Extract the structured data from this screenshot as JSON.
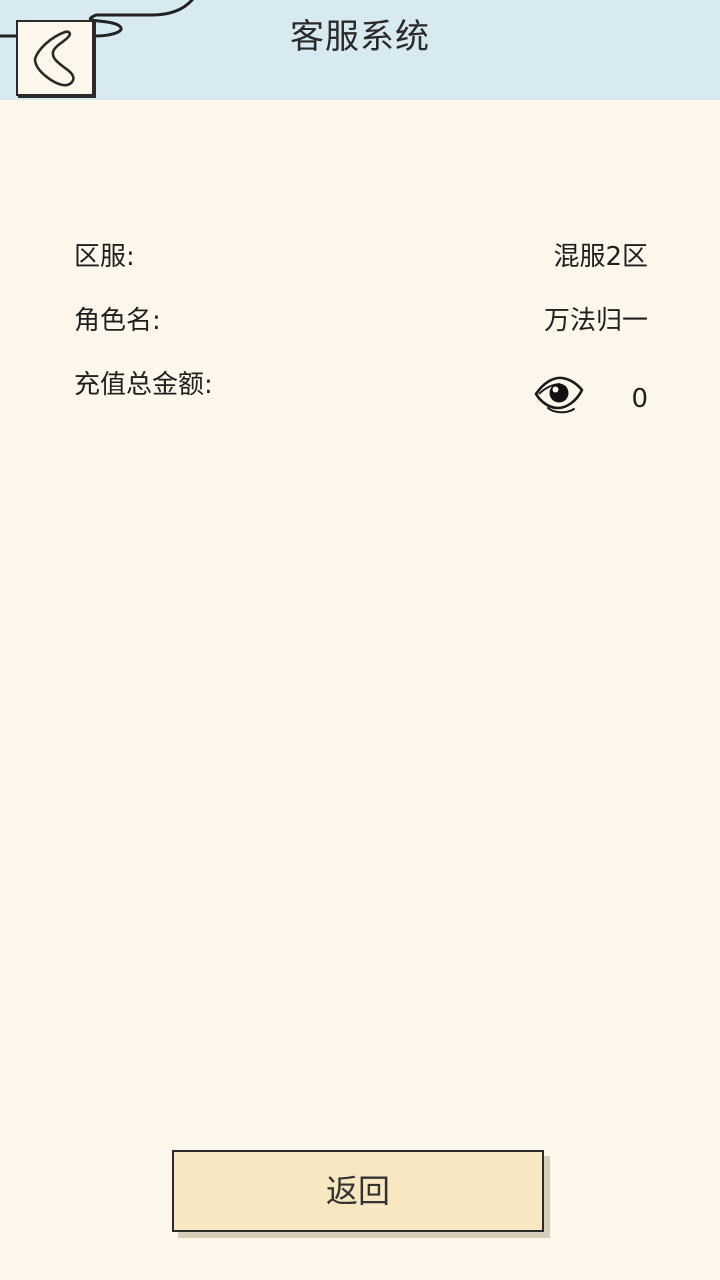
{
  "header": {
    "title": "客服系统",
    "background": "#d7e9f1",
    "back_icon": "chevron-left-icon"
  },
  "info": {
    "server_label": "区服:",
    "server_value": "混服2区",
    "role_label": "角色名:",
    "role_value": "万法归一",
    "recharge_label": "充值总金额:",
    "recharge_value": "0",
    "eye_icon": "eye-icon"
  },
  "footer": {
    "return_label": "返回",
    "button_color": "#f8e8c2"
  },
  "colors": {
    "background": "#fdf6ea",
    "text": "#1f1f1f"
  }
}
